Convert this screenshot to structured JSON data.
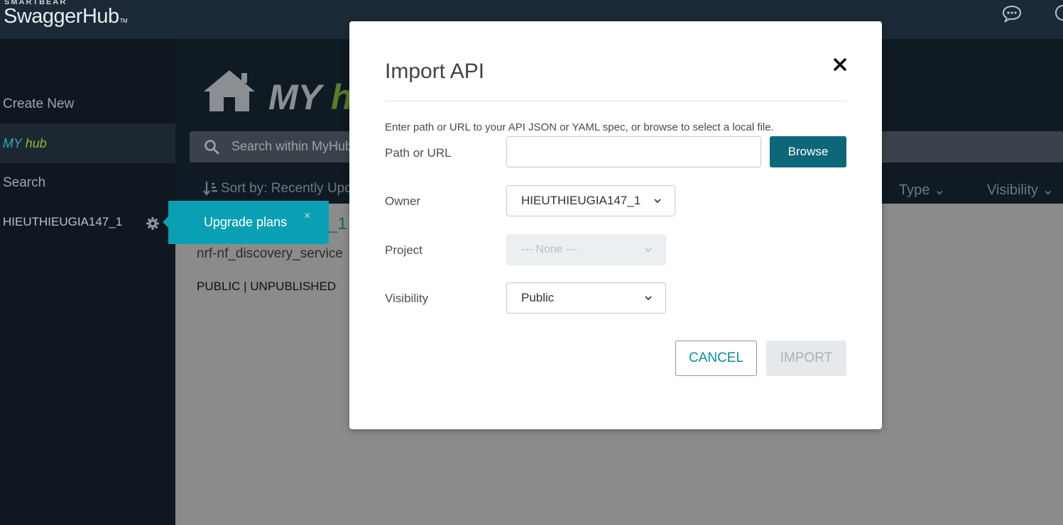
{
  "header": {
    "brand_small": "SMARTBEAR",
    "brand_main": "SwaggerHub",
    "brand_tm": "TM",
    "icons": [
      "chat-icon",
      "help-icon"
    ]
  },
  "sidebar": {
    "create_new": "Create New",
    "myhub_my": "MY",
    "myhub_hub": "hub",
    "search": "Search",
    "user": "HIEUTHIEUGIA147_1"
  },
  "main": {
    "title_my": "MY",
    "title_hub": "hu",
    "search_placeholder": "Search within MyHub",
    "sort_label": "Sort by: Recently Upd",
    "filter_type": "Type",
    "filter_visibility": "Visibility",
    "api_owner_fragment": "_1",
    "api_name": "nrf-nf_discovery_service",
    "api_status": "PUBLIC | UNPUBLISHED"
  },
  "upgrade_tooltip": {
    "label": "Upgrade plans",
    "close": "×"
  },
  "modal": {
    "title": "Import API",
    "description": "Enter path or URL to your API JSON or YAML spec, or browse to select a local file.",
    "path_label": "Path or URL",
    "path_value": "",
    "browse_label": "Browse",
    "owner_label": "Owner",
    "owner_value": "HIEUTHIEUGIA147_1",
    "project_label": "Project",
    "project_value": "--- None ---",
    "visibility_label": "Visibility",
    "visibility_value": "Public",
    "cancel_label": "CANCEL",
    "import_label": "IMPORT"
  },
  "colors": {
    "accent": "#0aa0b3",
    "primary_button": "#0e6679",
    "header_bg": "#1b2a36",
    "sidebar_bg": "#0f1821",
    "hub_green": "#8fb83a"
  }
}
